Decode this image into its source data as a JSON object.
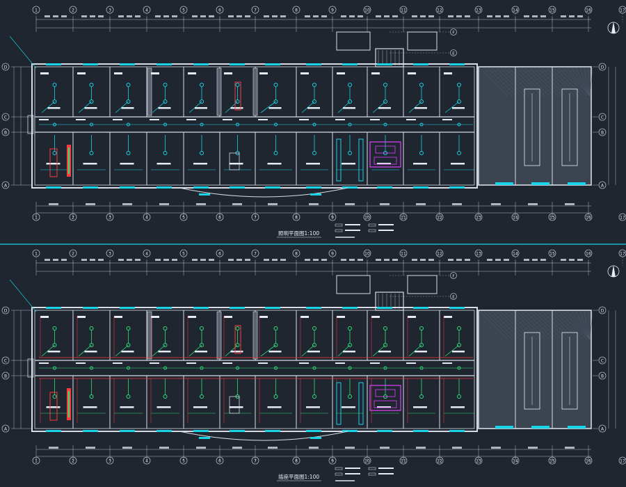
{
  "colors": {
    "background": "#1f2630",
    "wall": "#d8dde6",
    "grid_line": "#aeb6c2",
    "cyan": "#19d3e6",
    "green": "#2fe07a",
    "red": "#ff3b3b",
    "magenta": "#e040ff",
    "yellow": "#ffd64a",
    "label": "#e6ecf3"
  },
  "plans": [
    {
      "key": "lighting",
      "title": "照明平面图1:100",
      "axis_numbers": [
        "1",
        "2",
        "3",
        "4",
        "5",
        "6",
        "7",
        "8",
        "9",
        "10",
        "11",
        "12",
        "13",
        "14",
        "15",
        "16",
        "17"
      ],
      "axis_letters": [
        "D",
        "C",
        "B",
        "A"
      ],
      "extra_axes": [
        "F",
        "E"
      ],
      "wiring_color": "cyan"
    },
    {
      "key": "socket",
      "title": "插座平面图1:100",
      "axis_numbers": [
        "1",
        "2",
        "3",
        "4",
        "5",
        "6",
        "7",
        "8",
        "9",
        "10",
        "11",
        "12",
        "13",
        "14",
        "15",
        "16",
        "17"
      ],
      "axis_letters": [
        "D",
        "C",
        "B",
        "A"
      ],
      "extra_axes": [
        "F",
        "E"
      ],
      "wiring_color": "green"
    }
  ],
  "icons": {
    "north_arrow": "north-arrow-icon"
  }
}
